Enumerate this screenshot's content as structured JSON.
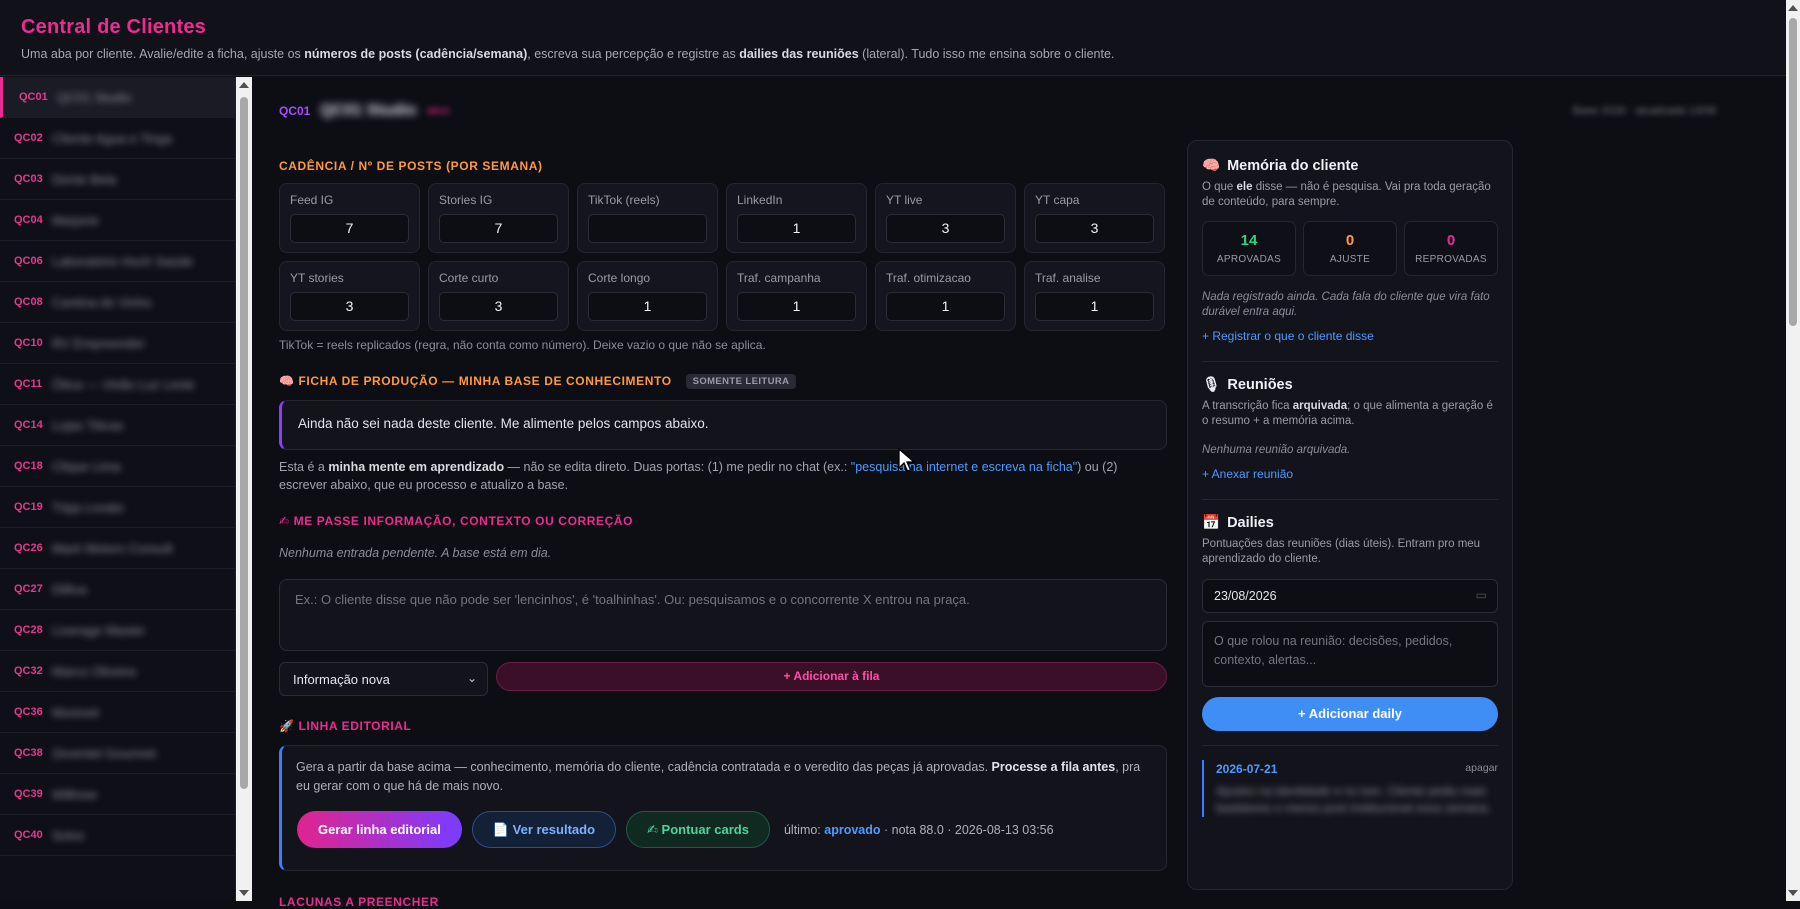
{
  "header": {
    "title": "Central de Clientes",
    "subtitle_1": "Uma aba por cliente. Avalie/edite a ficha, ajuste os ",
    "subtitle_b1": "números de posts (cadência/semana)",
    "subtitle_2": ", escreva sua percepção e registre as ",
    "subtitle_b2": "dailies das reuniões",
    "subtitle_3": " (lateral). Tudo isso me ensina sobre o cliente."
  },
  "sidebar": {
    "items": [
      {
        "code": "QC01",
        "name": "QC01 Studio"
      },
      {
        "code": "QC02",
        "name": "Cliente Agua e Tinga"
      },
      {
        "code": "QC03",
        "name": "Dente Bela"
      },
      {
        "code": "QC04",
        "name": "Marjorie"
      },
      {
        "code": "QC06",
        "name": "Laboratório Hoch Saúde"
      },
      {
        "code": "QC08",
        "name": "Cantina do Vinho"
      },
      {
        "code": "QC10",
        "name": "RV Empreender"
      },
      {
        "code": "QC11",
        "name": "Ótica — Visão Luz Leste"
      },
      {
        "code": "QC14",
        "name": "Lojas Titicas"
      },
      {
        "code": "QC18",
        "name": "Clique Lima"
      },
      {
        "code": "QC19",
        "name": "Tripp Lovato"
      },
      {
        "code": "QC26",
        "name": "Maré Motors Consult"
      },
      {
        "code": "QC27",
        "name": "Dilliva"
      },
      {
        "code": "QC28",
        "name": "Liverage Master"
      },
      {
        "code": "QC32",
        "name": "Marco Oliveira"
      },
      {
        "code": "QC36",
        "name": "Murexet"
      },
      {
        "code": "QC38",
        "name": "Zeventel Gourmet"
      },
      {
        "code": "QC39",
        "name": "Willnow"
      },
      {
        "code": "QC40",
        "name": "Solvo"
      }
    ]
  },
  "client": {
    "code": "QC01",
    "name": "QC01 Studio",
    "tag": "ativo",
    "meta": "Base 2026 · atualizada 13/08"
  },
  "cadence": {
    "title": "CADÊNCIA / Nº DE POSTS (POR SEMANA)",
    "cards": [
      {
        "label": "Feed IG",
        "value": "7"
      },
      {
        "label": "Stories IG",
        "value": "7"
      },
      {
        "label": "TikTok (reels)",
        "value": ""
      },
      {
        "label": "LinkedIn",
        "value": "1"
      },
      {
        "label": "YT live",
        "value": "3"
      },
      {
        "label": "YT capa",
        "value": "3"
      },
      {
        "label": "YT stories",
        "value": "3"
      },
      {
        "label": "Corte curto",
        "value": "3"
      },
      {
        "label": "Corte longo",
        "value": "1"
      },
      {
        "label": "Traf. campanha",
        "value": "1"
      },
      {
        "label": "Traf. otimizacao",
        "value": "1"
      },
      {
        "label": "Traf. analise",
        "value": "1"
      }
    ],
    "hint": "TikTok = reels replicados (regra, não conta como número). Deixe vazio o que não se aplica."
  },
  "ficha": {
    "icon": "brain-icon",
    "title": "FICHA DE PRODUÇÃO — MINHA BASE DE CONHECIMENTO",
    "badge": "SOMENTE LEITURA",
    "box_text": "Ainda não sei nada deste cliente. Me alimente pelos campos abaixo.",
    "para_1": "Esta é a ",
    "para_b": "minha mente em aprendizado",
    "para_2": " — não se edita direto. Duas portas: (1) me pedir no chat (ex.: ",
    "para_link": "\"pesquisa na internet e escreva na ficha\"",
    "para_3": ") ou (2) escrever abaixo, que eu processo e atualizo a base."
  },
  "input_section": {
    "icon": "writing-hand-icon",
    "title": "ME PASSE INFORMAÇÃO, CONTEXTO OU CORREÇÃO",
    "empty_note": "Nenhuma entrada pendente. A base está em dia.",
    "placeholder": "Ex.: O cliente disse que não pode ser 'lencinhos', é 'toalhinhas'. Ou: pesquisamos e o concorrente X entrou na praça.",
    "select_value": "Informação nova",
    "queue_button": "+ Adicionar à fila"
  },
  "editorial": {
    "icon": "rocket-icon",
    "title": "LINHA EDITORIAL",
    "text_1": "Gera a partir da base acima — conhecimento, memória do cliente, cadência contratada e o veredito das peças já aprovadas. ",
    "text_b": "Processe a fila antes",
    "text_2": ", pra eu gerar com o que há de mais novo.",
    "btn_generate": "Gerar linha editorial",
    "btn_result": "Ver resultado",
    "btn_score": "Pontuar cards",
    "status_prefix": "último: ",
    "status_value": "aprovado",
    "status_suffix": " · nota 88.0 · 2026-08-13 03:56"
  },
  "next_section": {
    "title": "LACUNAS A PREENCHER"
  },
  "memory": {
    "icon": "brain-icon",
    "title": "Memória do cliente",
    "sub_1": "O que ",
    "sub_b": "ele",
    "sub_2": " disse — não é pesquisa. Vai pra toda geração de conteúdo, para sempre.",
    "stats": [
      {
        "n": "14",
        "label": "APROVADAS",
        "color": "#2ed47a"
      },
      {
        "n": "0",
        "label": "AJUSTE",
        "color": "#ff9a3c"
      },
      {
        "n": "0",
        "label": "REPROVADAS",
        "color": "#ec2c8f"
      }
    ],
    "note": "Nada registrado ainda. Cada fala do cliente que vira fato durável entra aqui.",
    "link": "+ Registrar o que o cliente disse"
  },
  "meetings": {
    "icon": "microphone-icon",
    "title": "Reuniões",
    "sub_1": "A transcrição fica ",
    "sub_b": "arquivada",
    "sub_2": "; o que alimenta a geração é o resumo + a memória acima.",
    "note": "Nenhuma reunião arquivada.",
    "link": "+ Anexar reunião"
  },
  "dailies": {
    "icon": "calendar-icon",
    "title": "Dailies",
    "sub": "Pontuações das reuniões (dias úteis). Entram pro meu aprendizado do cliente.",
    "date_value": "23/08/2026",
    "placeholder": "O que rolou na reunião: decisões, pedidos, contexto, alertas...",
    "button": "+ Adicionar daily",
    "entry_date": "2026-07-21",
    "entry_delete": "apagar",
    "entry_text": "Ajustes na identidade e no tom. Cliente pediu mais bastidores e menos post institucional essa semana."
  }
}
